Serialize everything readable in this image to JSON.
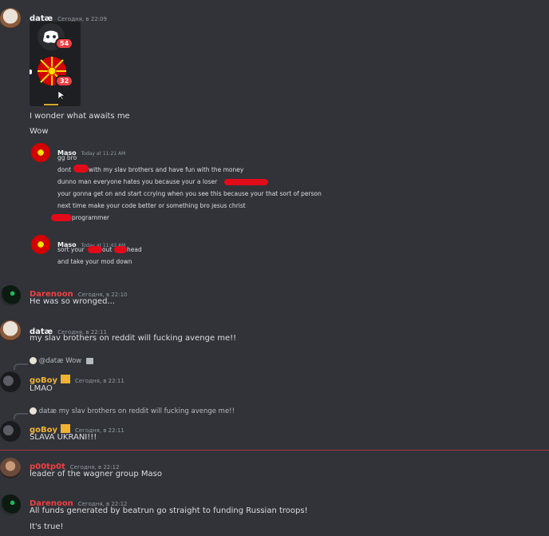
{
  "messages": [
    {
      "author": "datæ",
      "time": "Сегодня, в 22:09",
      "lines": [
        "I wonder what awaits me",
        "Wow"
      ]
    },
    {
      "author": "Darenoon",
      "time": "Сегодня, в 22:10",
      "lines": [
        "He was so wronged..."
      ]
    },
    {
      "author": "datæ",
      "time": "Сегодня, в 22:11",
      "lines": [
        "my slav brothers on reddit will fucking avenge me!!"
      ]
    },
    {
      "author": "goBoy",
      "time": "Сегодня, в 22:11",
      "reply_to": "@datæ Wow",
      "lines": [
        "LMAO"
      ]
    },
    {
      "author": "goBoy",
      "time": "Сегодня, в 22:11",
      "reply_to": "datæ my slav brothers on reddit will fucking avenge me!!",
      "lines": [
        "SLAVA UKRANI!!!"
      ]
    },
    {
      "author": "p00tp0t",
      "time": "Сегодня, в 22:12",
      "lines": [
        "leader of the wagner group Maso"
      ]
    },
    {
      "author": "Darenoon",
      "time": "Сегодня, в 22:12",
      "lines": [
        "All funds generated by beatrun go straight to funding Russian troops!",
        "It's true!"
      ]
    }
  ],
  "screenshot_badges": [
    "54",
    "32"
  ],
  "quoted": [
    {
      "author": "Maso",
      "time": "Today at 11:21 AM",
      "lines": [
        "gg bro",
        "dont",
        "with my slav brothers and have fun with the money",
        "dunno man everyone hates you because your a loser",
        "your gonna get on and start ccrying when you see this because your that sort of person",
        "next time make your code better or something bro jesus christ",
        "programmer"
      ]
    },
    {
      "author": "Maso",
      "time": "Today at 11:43 AM",
      "lines": [
        "sort your",
        "out",
        "head",
        "and take your mod down"
      ]
    }
  ],
  "colors": {
    "background": "#313338",
    "red_name": "#f23f42",
    "gold_name": "#f0b232",
    "divider": "#a8323b"
  },
  "icons": [
    "discord-icon",
    "macedonian-flag-icon",
    "cursor-icon",
    "reply-image-icon",
    "server-tag-icon"
  ]
}
